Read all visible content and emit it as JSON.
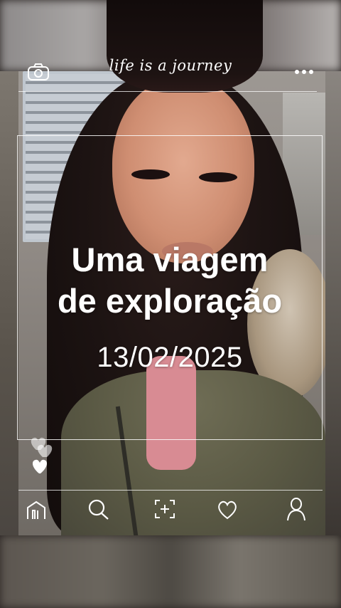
{
  "header": {
    "brand_text": "life is a journey",
    "camera_icon": "camera-icon",
    "more_icon": "more-dots-icon"
  },
  "card": {
    "title_line1": "Uma viagem",
    "title_line2": "de exploração",
    "date": "13/02/2025"
  },
  "reactions": {
    "icon": "heart-stack-icon"
  },
  "bottom_nav": {
    "items": [
      {
        "icon": "home-icon"
      },
      {
        "icon": "search-icon"
      },
      {
        "icon": "add-post-icon"
      },
      {
        "icon": "heart-icon"
      },
      {
        "icon": "profile-icon"
      }
    ]
  },
  "colors": {
    "overlay_white": "#ffffff"
  }
}
